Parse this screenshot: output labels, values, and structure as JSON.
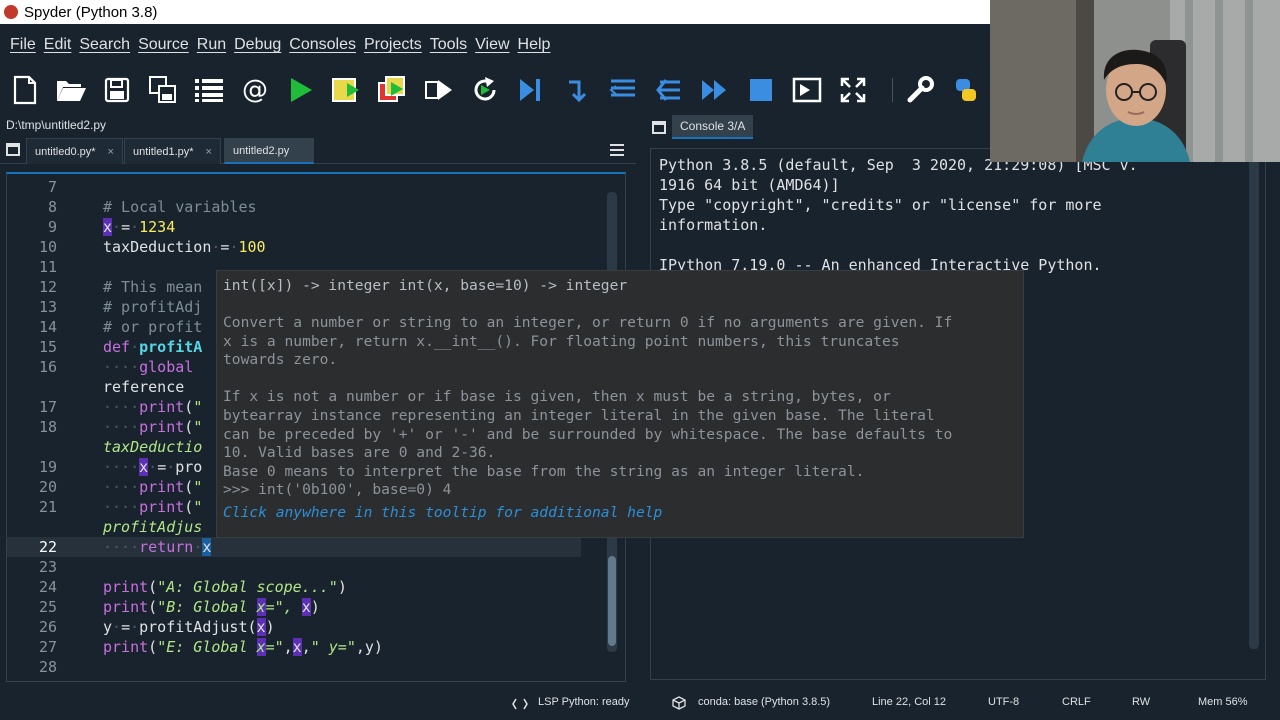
{
  "window": {
    "title": "Spyder (Python 3.8)"
  },
  "menu": [
    "File",
    "Edit",
    "Search",
    "Source",
    "Run",
    "Debug",
    "Consoles",
    "Projects",
    "Tools",
    "View",
    "Help"
  ],
  "toolbar": [
    "new-file-icon",
    "open-file-icon",
    "save-icon",
    "save-all-icon",
    "list-icon",
    "at-icon",
    "run-icon",
    "run-cell-icon",
    "run-cell-advance-icon",
    "run-selection-icon",
    "rerun-icon",
    "debug-step-icon",
    "debug-icon-1",
    "debug-icon-2",
    "debug-icon-3",
    "continue-icon",
    "stop-icon",
    "maximize-pane-icon",
    "fullscreen-icon",
    "wrench-icon",
    "python-icon"
  ],
  "editor": {
    "path": "D:\\tmp\\untitled2.py",
    "tabs": [
      {
        "label": "untitled0.py*",
        "close": "×"
      },
      {
        "label": "untitled1.py*",
        "close": "×"
      },
      {
        "label": "untitled2.py"
      }
    ],
    "line_numbers": [
      "7",
      "8",
      "9",
      "10",
      "11",
      "12",
      "13",
      "14",
      "15",
      "16",
      "",
      "17",
      "18",
      "",
      "19",
      "20",
      "21",
      "",
      "22",
      "23",
      "24",
      "25",
      "26",
      "27",
      "28"
    ]
  },
  "tooltip": {
    "signature": "int([x]) -> integer int(x, base=10) -> integer",
    "lines": [
      "Convert a number or string to an integer, or return 0 if no arguments are given. If",
      "x is a number, return x.__int__(). For floating point numbers, this truncates",
      "towards zero.",
      "",
      "If x is not a number or if base is given, then x must be a string, bytes, or",
      "bytearray instance representing an integer literal in the given base. The literal",
      "can be preceded by '+' or '-' and be surrounded by whitespace. The base defaults to",
      "10. Valid bases are 0 and 2-36.",
      "Base 0 means to interpret the base from the string as an integer literal.",
      ">>> int('0b100', base=0) 4"
    ],
    "help": "Click anywhere in this tooltip for additional help"
  },
  "console": {
    "tab": "Console 3/A",
    "lines": [
      "Python 3.8.5 (default, Sep  3 2020, 21:29:08) [MSC v.",
      "1916 64 bit (AMD64)]",
      "Type \"copyright\", \"credits\" or \"license\" for more",
      "information.",
      "",
      "IPython 7.19.0 -- An enhanced Interactive Python."
    ]
  },
  "status": {
    "lsp": "LSP Python: ready",
    "conda": "conda: base (Python 3.8.5)",
    "position": "Line 22, Col 12",
    "encoding": "UTF-8",
    "eol": "CRLF",
    "rw": "RW",
    "mem": "Mem 56%"
  }
}
